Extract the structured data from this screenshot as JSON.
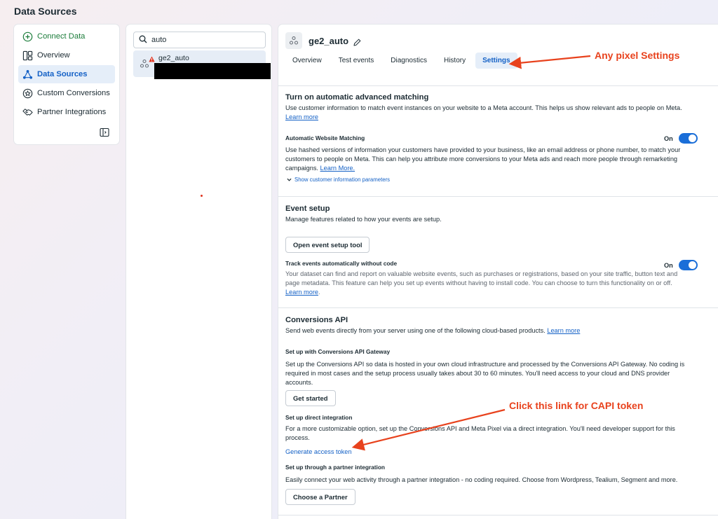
{
  "page": {
    "title": "Data Sources"
  },
  "sidebar": {
    "items": [
      {
        "label": "Connect Data",
        "icon": "plus-circle-icon"
      },
      {
        "label": "Overview",
        "icon": "layout-icon"
      },
      {
        "label": "Data Sources",
        "icon": "nodes-icon"
      },
      {
        "label": "Custom Conversions",
        "icon": "star-badge-icon"
      },
      {
        "label": "Partner Integrations",
        "icon": "handshake-icon"
      }
    ],
    "active": "Data Sources",
    "collapse_icon": "sidebar-toggle-icon"
  },
  "list": {
    "search": {
      "value": "auto",
      "icon": "search-icon"
    },
    "items": [
      {
        "name": "ge2_auto",
        "status": "warning"
      }
    ]
  },
  "detail": {
    "title": "ge2_auto",
    "tabs": [
      "Overview",
      "Test events",
      "Diagnostics",
      "History",
      "Settings"
    ],
    "active_tab": "Settings",
    "aam": {
      "heading": "Turn on automatic advanced matching",
      "desc": "Use customer information to match event instances on your website to a Meta account. This helps us show relevant ads to people on Meta.",
      "learn_more": "Learn more",
      "awm_title": "Automatic Website Matching",
      "awm_toggle": "On",
      "awm_desc": "Use hashed versions of information your customers have provided to your business, like an email address or phone number, to match your customers to people on Meta. This can help you attribute more conversions to your Meta ads and reach more people through remarketing campaigns.",
      "awm_link": "Learn More.",
      "show_params": "Show customer information parameters"
    },
    "event_setup": {
      "heading": "Event setup",
      "desc": "Manage features related to how your events are setup.",
      "button": "Open event setup tool",
      "track_title": "Track events automatically without code",
      "track_toggle": "On",
      "track_desc": "Your dataset can find and report on valuable website events, such as purchases or registrations, based on your site traffic, button text and page metadata. This feature can help you set up events without having to install code. You can choose to turn this functionality on or off.",
      "learn_more": "Learn more",
      "period": "."
    },
    "capi": {
      "heading": "Conversions API",
      "desc": "Send web events directly from your server using one of the following cloud-based products.",
      "learn_more": "Learn more",
      "gateway_title": "Set up with Conversions API Gateway",
      "gateway_desc": "Set up the Conversions API so data is hosted in your own cloud infrastructure and processed by the Conversions API Gateway. No coding is required in most cases and the setup process usually takes about 30 to 60 minutes. You'll need access to your cloud and DNS provider accounts.",
      "gateway_button": "Get started",
      "direct_title": "Set up direct integration",
      "direct_desc": "For a more customizable option, set up the Conversions API and Meta Pixel via a direct integration. You'll need developer support for this process.",
      "direct_link": "Generate access token",
      "partner_title": "Set up through a partner integration",
      "partner_desc": "Easily connect your web activity through a partner integration - no coding required. Choose from Wordpress, Tealium, Segment and more.",
      "partner_button": "Choose a Partner"
    }
  },
  "annotations": {
    "settings_note": "Any pixel Settings",
    "capi_note": "Click this link for CAPI token",
    "color": "#e8421d"
  },
  "colors": {
    "accent": "#1461c6",
    "toggle": "#1a6ed8",
    "success": "#1b7c3a"
  }
}
